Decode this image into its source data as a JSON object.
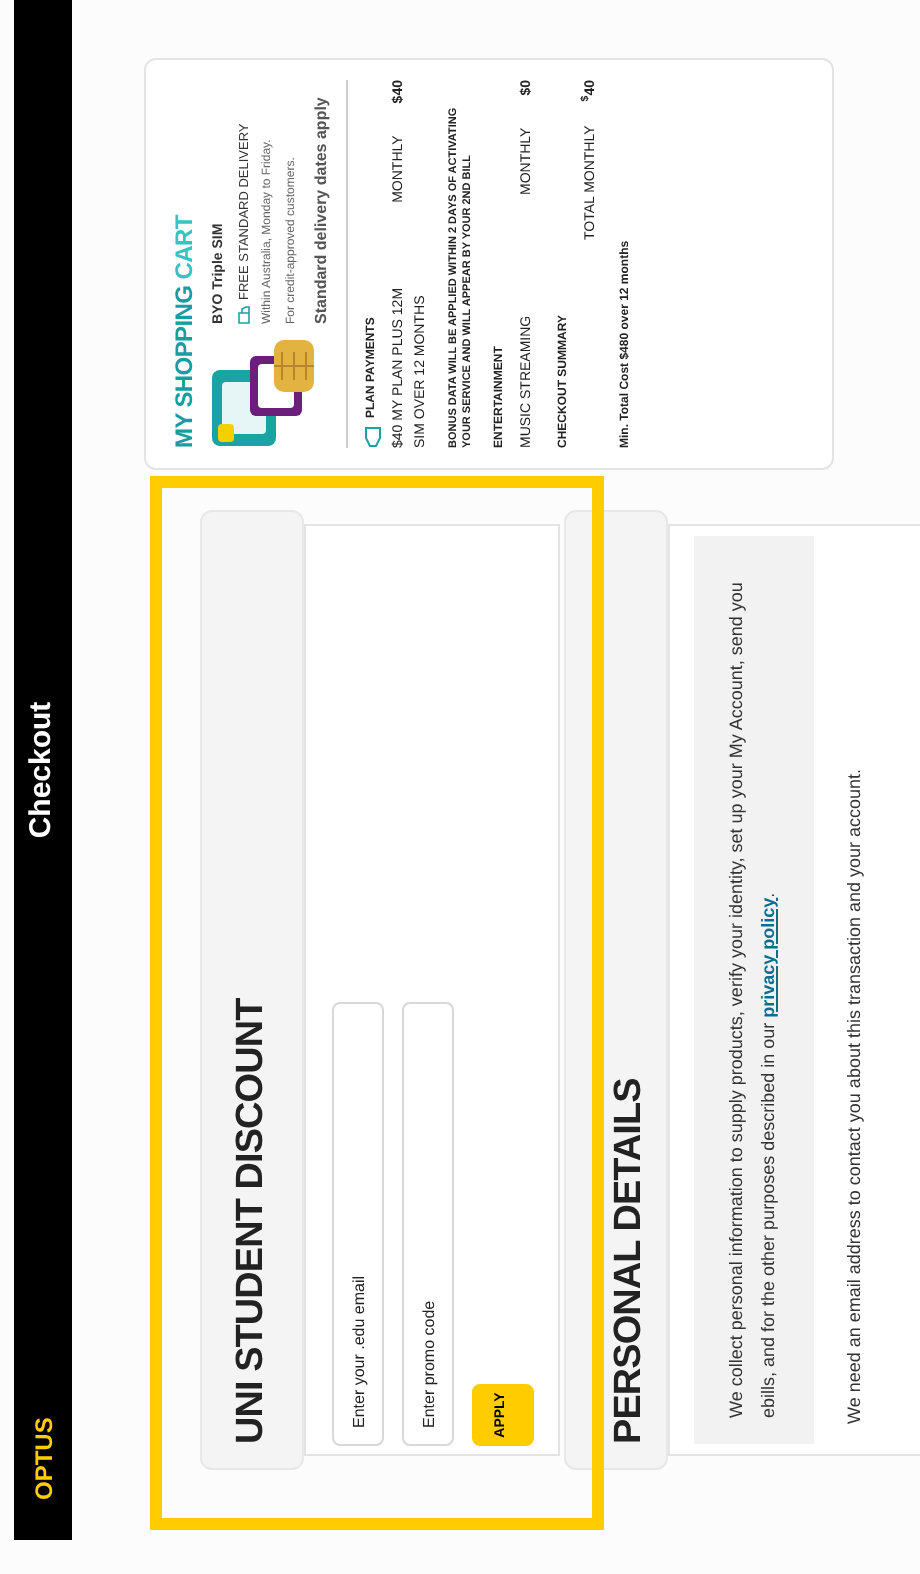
{
  "header": {
    "logo": "OPTUS",
    "title": "Checkout"
  },
  "uni_discount": {
    "title": "UNI STUDENT DISCOUNT",
    "highlighted": true,
    "fields": [
      {
        "placeholder": "Enter your .edu email"
      },
      {
        "placeholder": "Enter promo code"
      }
    ],
    "button": "APPLY"
  },
  "personal_details": {
    "title": "PERSONAL DETAILS",
    "notice": "We collect personal information to supply products, verify your identity, set up your My Account, send you ebills, and for the other purposes described in our",
    "notice_link": "privacy policy",
    "notice_end": ".",
    "email_note": "We need an email address to contact you about this transaction and your account."
  },
  "cart": {
    "title": "MY SHOPPING",
    "title_accent": "CART",
    "product": "BYO Triple SIM",
    "delivery": "FREE STANDARD DELIVERY",
    "delivery_notes": [
      "Within Australia, Monday to Friday.",
      "For credit-approved customers."
    ],
    "delivery_dates": "Standard delivery dates apply",
    "rows": [
      {
        "kind": "heading",
        "text": "PLAN PAYMENTS",
        "icon": true
      },
      {
        "kind": "item",
        "name": "$40 MY PLAN PLUS 12M SIM OVER 12 MONTHS",
        "period": "MONTHLY",
        "price": "$40"
      },
      {
        "kind": "note",
        "text": "BONUS DATA WILL BE APPLIED WITHIN 2 DAYS OF ACTIVATING YOUR SERVICE AND WILL APPEAR BY YOUR 2ND BILL"
      },
      {
        "kind": "heading",
        "text": "ENTERTAINMENT",
        "icon": false
      },
      {
        "kind": "item",
        "name": "MUSIC STREAMING",
        "period": "MONTHLY",
        "price": "$0"
      },
      {
        "kind": "heading",
        "text": "CHECKOUT SUMMARY",
        "icon": false
      },
      {
        "kind": "total",
        "label": "TOTAL MONTHLY",
        "currency": "$",
        "amount": "40"
      },
      {
        "kind": "footnote",
        "text": "Min. Total Cost $480 over 12 months"
      }
    ]
  }
}
